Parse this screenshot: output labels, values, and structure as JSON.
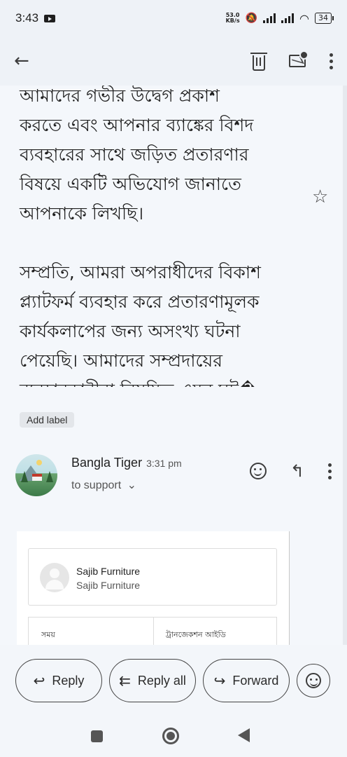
{
  "status_bar": {
    "time": "3:43",
    "speed_value": "53.0",
    "speed_unit": "KB/s",
    "battery": "34"
  },
  "toolbar": {
    "back_icon": "arrow-left-icon",
    "delete_icon": "trash-icon",
    "mark_unread_icon": "mail-unread-icon",
    "more_icon": "more-vert-icon"
  },
  "message": {
    "body_top": "আমাদের গভীর উদ্বেগ প্রকাশ\nকরতে এবং আপনার ব্যাঙ্কের বিশদ\nব্যবহারের সাথে জড়িত প্রতারণার\nবিষয়ে একটি অভিযোগ জানাতে\nআপনাকে লিখছি।",
    "body_bottom": "সম্প্রতি, আমরা অপরাধীদের বিকাশ\nপ্ল্যাটফর্ম ব্যবহার করে প্রতারণামূলক\nকার্যকলাপের জন্য অসংখ্য ঘটনা\nপেয়েছি। আমাদের সম্প্রদায়ের\nব্যবহারকারীরা নিয়মিত এমন ঘট�",
    "star_icon": "star-outline-icon",
    "label_chip": "Add label"
  },
  "sender": {
    "name": "Bangla Tiger",
    "time": "3:31 pm",
    "to": "to support",
    "chevron": "⌄"
  },
  "embedded": {
    "card_title": "Sajib Furniture",
    "card_subtitle": "Sajib Furniture",
    "col_time": "সময়",
    "col_txn": "ট্রানজেকশন আইডি"
  },
  "actions": {
    "reply": "Reply",
    "reply_all": "Reply all",
    "forward": "Forward"
  }
}
